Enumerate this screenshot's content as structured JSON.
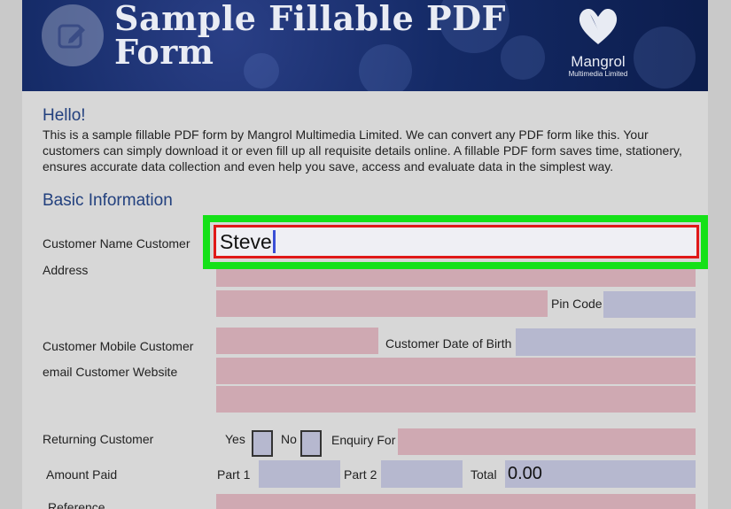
{
  "banner": {
    "title_line1": "Sample Fillable PDF",
    "title_line2": "Form",
    "brand_name": "Mangrol",
    "brand_sub": "Multimedia Limited",
    "icon": "edit-icon"
  },
  "intro": {
    "heading": "Hello!",
    "body": "This is a sample fillable PDF form by Mangrol Multimedia Limited. We can convert any PDF form like this. Your customers can simply download it or even fill up all requisite details online. A fillable PDF form saves time, stationery, ensures accurate data collection and even help you save, access and evaluate data in the simplest way."
  },
  "form": {
    "section_title": "Basic Information",
    "labels": {
      "customer_name": "Customer Name Customer",
      "address": "Address",
      "pin_code": "Pin Code",
      "mobile": "Customer Mobile  Customer",
      "email_website": "email Customer Website",
      "dob": "Customer Date of Birth",
      "returning": "Returning Customer",
      "yes": "Yes",
      "no": "No",
      "enquiry": "Enquiry For",
      "amount_paid": "Amount Paid",
      "part1": "Part 1",
      "part2": "Part 2",
      "total": "Total",
      "reference": "Reference"
    },
    "values": {
      "customer_name": "Steve",
      "total": "0.00"
    }
  },
  "colors": {
    "field_pink": "#cfa9b2",
    "field_blue": "#b6b8cf",
    "highlight": "#15e118",
    "active_border": "#e01818",
    "heading": "#22407e"
  }
}
